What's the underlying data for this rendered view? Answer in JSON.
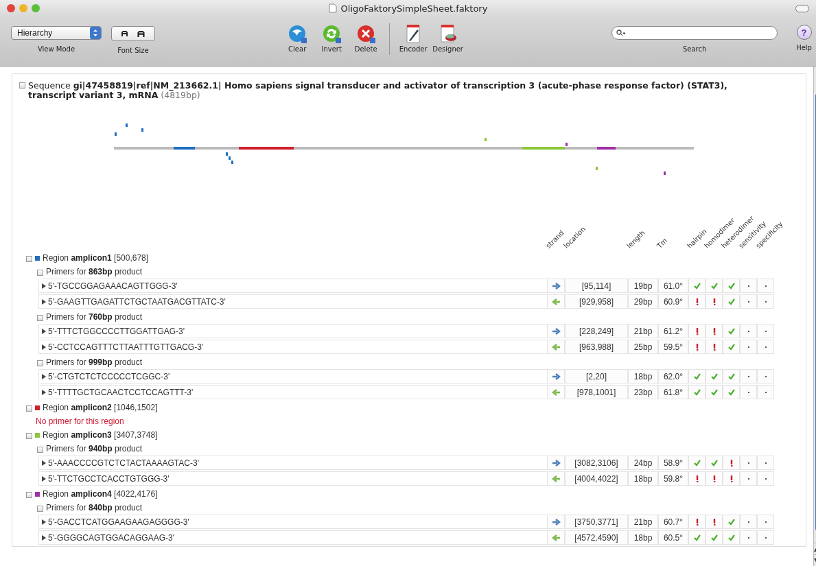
{
  "window": {
    "title": "OligoFaktorySimpleSheet.faktory"
  },
  "toolbar": {
    "view_mode": {
      "value": "Hierarchy",
      "label": "View Mode"
    },
    "font_size": {
      "label": "Font Size"
    },
    "buttons": [
      {
        "kind": "clear",
        "label": "Clear"
      },
      {
        "kind": "invert",
        "label": "Invert"
      },
      {
        "kind": "delete",
        "label": "Delete"
      },
      {
        "kind": "encoder",
        "label": "Encoder"
      },
      {
        "kind": "designer",
        "label": "Designer"
      }
    ],
    "search": {
      "label": "Search"
    },
    "help": {
      "symbol": "?",
      "label": "Help"
    }
  },
  "sequence": {
    "title": "Sequence **gi|47458819|ref|NM_213662.1| Homo sapiens signal transducer and activator of transcription 3 (acute-phase response factor) (STAT3), transcript variant 3, mRNA**",
    "length": "(4819bp)"
  },
  "columns": [
    "strand",
    "location",
    "length",
    "Tm",
    "hairpin",
    "homodimer",
    "heterodimer",
    "sensitivity",
    "specificity"
  ],
  "regions": [
    {
      "label": "Region **amplicon1** [500,678]",
      "color": "#1f6fc0",
      "primer_sets": [
        {
          "label": "Primers for **863bp** product",
          "primers": [
            {
              "sequence": "5'-TGCCGGAGAAACAGTTGGG-3'",
              "strand": {
                "kind": "forward"
              },
              "location": "[95,114]",
              "length": "19bp",
              "tm": "61.0°",
              "checks": [
                {
                  "kind": "pass"
                },
                {
                  "kind": "pass"
                },
                {
                  "kind": "pass"
                },
                {
                  "kind": "none"
                },
                {
                  "kind": "none"
                }
              ]
            },
            {
              "sequence": "5'-GAAGTTGAGATTCTGCTAATGACGTTATC-3'",
              "strand": {
                "kind": "reverse"
              },
              "location": "[929,958]",
              "length": "29bp",
              "tm": "60.9°",
              "checks": [
                {
                  "kind": "fail"
                },
                {
                  "kind": "fail"
                },
                {
                  "kind": "pass"
                },
                {
                  "kind": "none"
                },
                {
                  "kind": "none"
                }
              ]
            }
          ]
        },
        {
          "label": "Primers for **760bp** product",
          "primers": [
            {
              "sequence": "5'-TTTCTGGCCCCTTGGATTGAG-3'",
              "strand": {
                "kind": "forward"
              },
              "location": "[228,249]",
              "length": "21bp",
              "tm": "61.2°",
              "checks": [
                {
                  "kind": "fail"
                },
                {
                  "kind": "fail"
                },
                {
                  "kind": "pass"
                },
                {
                  "kind": "none"
                },
                {
                  "kind": "none"
                }
              ]
            },
            {
              "sequence": "5'-CCTCCAGTTTCTTAATTTGTTGACG-3'",
              "strand": {
                "kind": "reverse"
              },
              "location": "[963,988]",
              "length": "25bp",
              "tm": "59.5°",
              "checks": [
                {
                  "kind": "fail"
                },
                {
                  "kind": "fail"
                },
                {
                  "kind": "pass"
                },
                {
                  "kind": "none"
                },
                {
                  "kind": "none"
                }
              ]
            }
          ]
        },
        {
          "label": "Primers for **999bp** product",
          "primers": [
            {
              "sequence": "5'-CTGTCTCTCCCCCTCGGC-3'",
              "strand": {
                "kind": "forward"
              },
              "location": "[2,20]",
              "length": "18bp",
              "tm": "62.0°",
              "checks": [
                {
                  "kind": "pass"
                },
                {
                  "kind": "pass"
                },
                {
                  "kind": "pass"
                },
                {
                  "kind": "none"
                },
                {
                  "kind": "none"
                }
              ]
            },
            {
              "sequence": "5'-TTTTGCTGCAACTCCTCCAGTTT-3'",
              "strand": {
                "kind": "reverse"
              },
              "location": "[978,1001]",
              "length": "23bp",
              "tm": "61.8°",
              "checks": [
                {
                  "kind": "pass"
                },
                {
                  "kind": "pass"
                },
                {
                  "kind": "pass"
                },
                {
                  "kind": "none"
                },
                {
                  "kind": "none"
                }
              ]
            }
          ]
        }
      ]
    },
    {
      "label": "Region **amplicon2** [1046,1502]",
      "color": "#d0202a",
      "note": "No primer for this region"
    },
    {
      "label": "Region **amplicon3** [3407,3748]",
      "color": "#8cc63a",
      "primer_sets": [
        {
          "label": "Primers for **940bp** product",
          "primers": [
            {
              "sequence": "5'-AAACCCCGTCTCTACTAAAAGTAC-3'",
              "strand": {
                "kind": "forward"
              },
              "location": "[3082,3106]",
              "length": "24bp",
              "tm": "58.9°",
              "checks": [
                {
                  "kind": "pass"
                },
                {
                  "kind": "pass"
                },
                {
                  "kind": "fail"
                },
                {
                  "kind": "none"
                },
                {
                  "kind": "none"
                }
              ]
            },
            {
              "sequence": "5'-TTCTGCCTCACCTGTGGG-3'",
              "strand": {
                "kind": "reverse"
              },
              "location": "[4004,4022]",
              "length": "18bp",
              "tm": "59.8°",
              "checks": [
                {
                  "kind": "fail"
                },
                {
                  "kind": "fail"
                },
                {
                  "kind": "fail"
                },
                {
                  "kind": "none"
                },
                {
                  "kind": "none"
                }
              ]
            }
          ]
        }
      ]
    },
    {
      "label": "Region **amplicon4** [4022,4176]",
      "color": "#a030a8",
      "primer_sets": [
        {
          "label": "Primers for **840bp** product",
          "primers": [
            {
              "sequence": "5'-GACCTCATGGAAGAAGAGGGG-3'",
              "strand": {
                "kind": "forward"
              },
              "location": "[3750,3771]",
              "length": "21bp",
              "tm": "60.7°",
              "checks": [
                {
                  "kind": "fail"
                },
                {
                  "kind": "fail"
                },
                {
                  "kind": "pass"
                },
                {
                  "kind": "none"
                },
                {
                  "kind": "none"
                }
              ]
            },
            {
              "sequence": "5'-GGGGCAGTGGACAGGAAG-3'",
              "strand": {
                "kind": "reverse"
              },
              "location": "[4572,4590]",
              "length": "18bp",
              "tm": "60.5°",
              "checks": [
                {
                  "kind": "pass"
                },
                {
                  "kind": "pass"
                },
                {
                  "kind": "pass"
                },
                {
                  "kind": "none"
                },
                {
                  "kind": "none"
                }
              ]
            }
          ]
        }
      ]
    }
  ]
}
